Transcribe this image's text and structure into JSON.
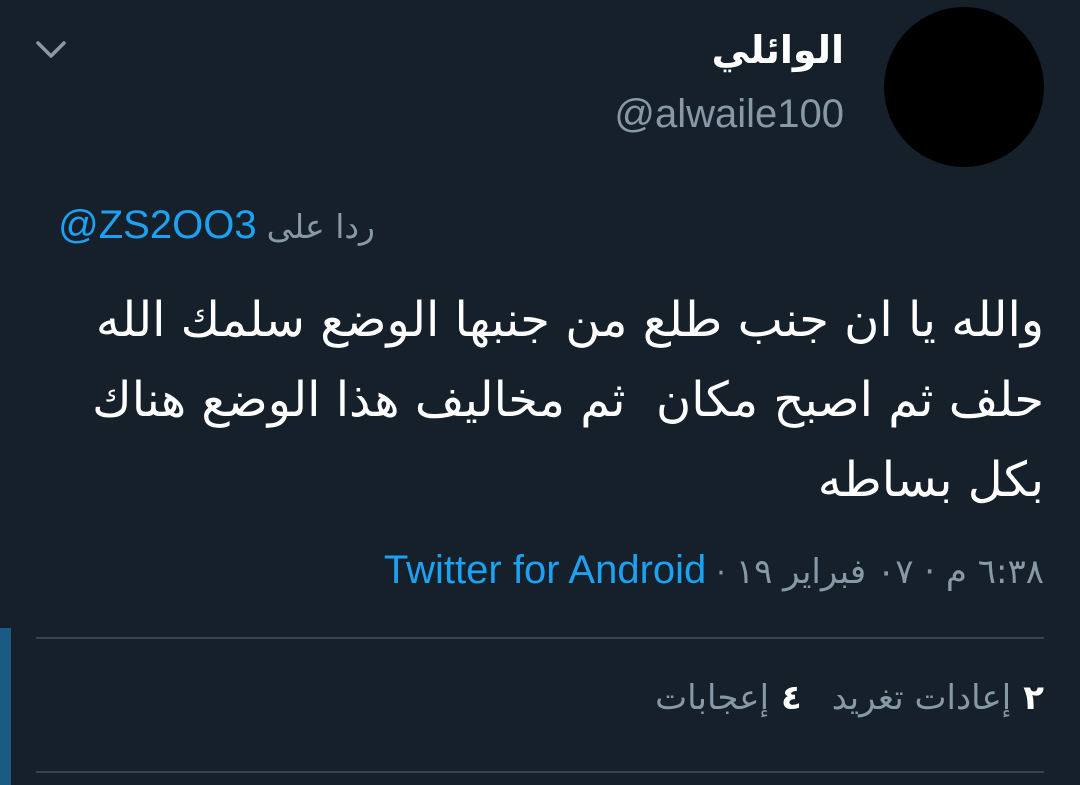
{
  "user": {
    "display_name": "الوائلي",
    "handle": "@alwaile100"
  },
  "reply": {
    "label": "ردا على",
    "mention": "@ZS2OO3"
  },
  "tweet": {
    "text": "والله يا ان جنب طلع من جنبها الوضع سلمك الله حلف ثم اصبح مكان  ثم مخاليف هذا الوضع هناك بكل بساطه"
  },
  "meta": {
    "time_date": "٦:٣٨ م · ٠٧ فبراير ١٩",
    "separator": "·",
    "source": "Twitter for Android"
  },
  "stats": {
    "retweets_count": "٢",
    "retweets_label": "إعادات تغريد",
    "likes_count": "٤",
    "likes_label": "إعجابات"
  },
  "icons": {
    "collapse": "chevron-down-icon"
  },
  "colors": {
    "background": "#15202b",
    "accent": "#1da1f2",
    "secondary_text": "#8899a6",
    "divider": "#38444d"
  }
}
